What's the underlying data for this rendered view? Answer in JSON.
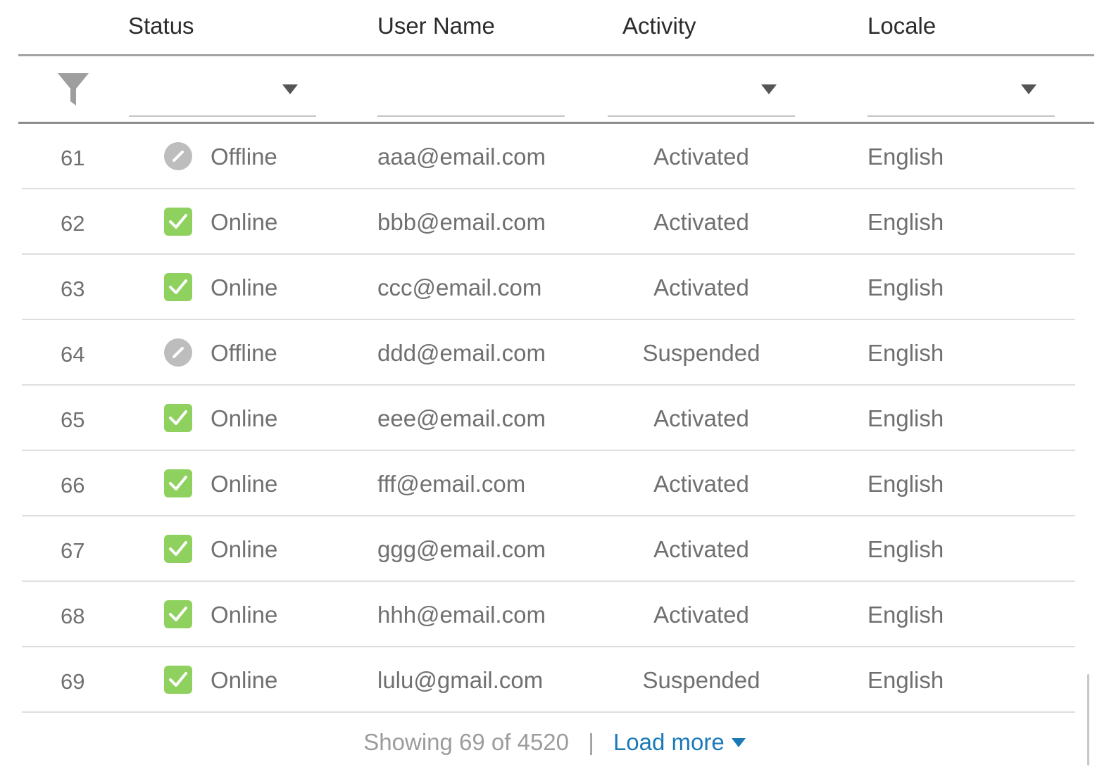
{
  "header": {
    "status": "Status",
    "user_name": "User Name",
    "activity": "Activity",
    "locale": "Locale"
  },
  "filters": {
    "funnel_icon": "filter-funnel-icon",
    "status_value": "",
    "user_name_value": "",
    "activity_value": "",
    "locale_value": ""
  },
  "colors": {
    "online": "#8fd15f",
    "offline": "#bdbdbd",
    "link": "#1a7ab8"
  },
  "rows": [
    {
      "num": "61",
      "status": "Offline",
      "icon": "offline-icon",
      "user": "aaa@email.com",
      "activity": "Activated",
      "locale": "English"
    },
    {
      "num": "62",
      "status": "Online",
      "icon": "online-check-icon",
      "user": "bbb@email.com",
      "activity": "Activated",
      "locale": "English"
    },
    {
      "num": "63",
      "status": "Online",
      "icon": "online-check-icon",
      "user": "ccc@email.com",
      "activity": "Activated",
      "locale": "English"
    },
    {
      "num": "64",
      "status": "Offline",
      "icon": "offline-icon",
      "user": "ddd@email.com",
      "activity": "Suspended",
      "locale": "English"
    },
    {
      "num": "65",
      "status": "Online",
      "icon": "online-check-icon",
      "user": "eee@email.com",
      "activity": "Activated",
      "locale": "English"
    },
    {
      "num": "66",
      "status": "Online",
      "icon": "online-check-icon",
      "user": "fff@email.com",
      "activity": "Activated",
      "locale": "English"
    },
    {
      "num": "67",
      "status": "Online",
      "icon": "online-check-icon",
      "user": "ggg@email.com",
      "activity": "Activated",
      "locale": "English"
    },
    {
      "num": "68",
      "status": "Online",
      "icon": "online-check-icon",
      "user": "hhh@email.com",
      "activity": "Activated",
      "locale": "English"
    },
    {
      "num": "69",
      "status": "Online",
      "icon": "online-check-icon",
      "user": "lulu@gmail.com",
      "activity": "Suspended",
      "locale": "English"
    }
  ],
  "footer": {
    "showing": "Showing 69 of 4520",
    "separator": "|",
    "load_more": "Load more"
  }
}
